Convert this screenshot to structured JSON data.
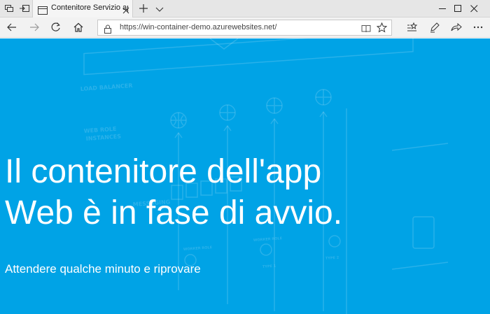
{
  "browser": {
    "tab": {
      "title": "Contenitore Servizio app"
    },
    "address_bar": {
      "url": "https://win-container-demo.azurewebsites.net/"
    }
  },
  "page": {
    "headline_line1": "Il contenitore dell'app",
    "headline_line2": "Web è in fase di avvio.",
    "subtitle": "Attendere qualche minuto e riprovare",
    "background_color": "#00a3e6",
    "background_labels": [
      "LOAD BALANCER",
      "WEB ROLE",
      "INSTANCES",
      "MESSAGING",
      "WORKER ROLE",
      "WORKER ROLE",
      "TYPE 1",
      "TYPE 2"
    ]
  }
}
